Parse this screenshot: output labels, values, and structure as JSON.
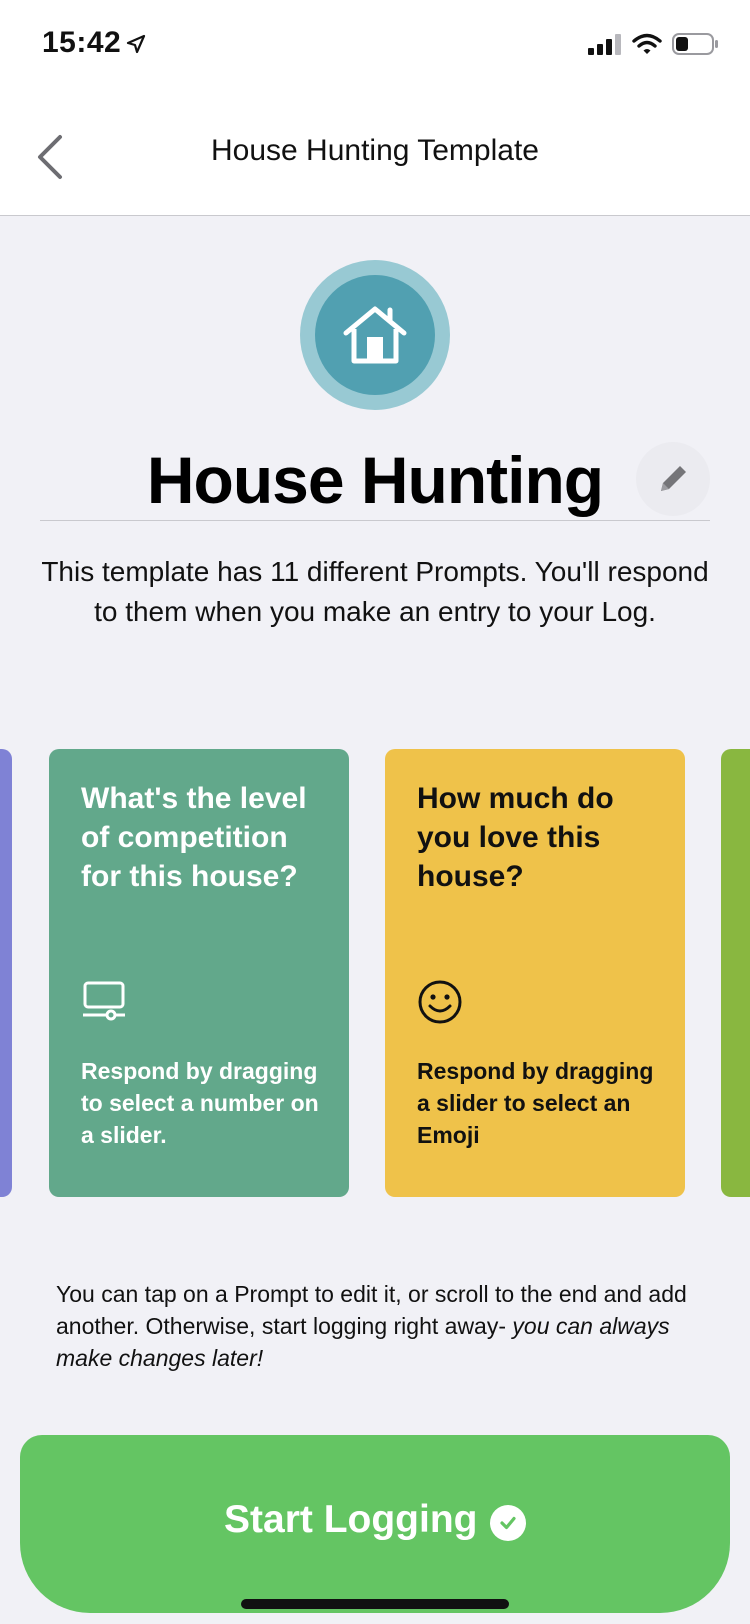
{
  "status_bar": {
    "time": "15:42"
  },
  "nav": {
    "title": "House Hunting Template"
  },
  "template": {
    "name": "House Hunting",
    "description": "This template has 11 different Prompts. You'll respond to them when you make an entry to your Log."
  },
  "prompts": [
    {
      "question": "What's the level of competition for this house?",
      "response": "Respond by dragging to select a number on a slider.",
      "icon": "slider-number-icon",
      "color": "#62a88b"
    },
    {
      "question": "How much do you love this house?",
      "response": "Respond by dragging a slider to select an Emoji",
      "icon": "smiley-icon",
      "color": "#efc24a"
    }
  ],
  "hint": {
    "text": "You can tap on a Prompt to edit it, or scroll to the end and add another. Otherwise, start logging right away- ",
    "italic": "you can always make changes later!"
  },
  "start_button": {
    "label": "Start Logging"
  },
  "colors": {
    "accent_green": "#64c563",
    "hero_outer": "#98c9d3",
    "hero_inner": "#51a0b1",
    "card_purple": "#7f82d5",
    "card_lime": "#89b740"
  }
}
